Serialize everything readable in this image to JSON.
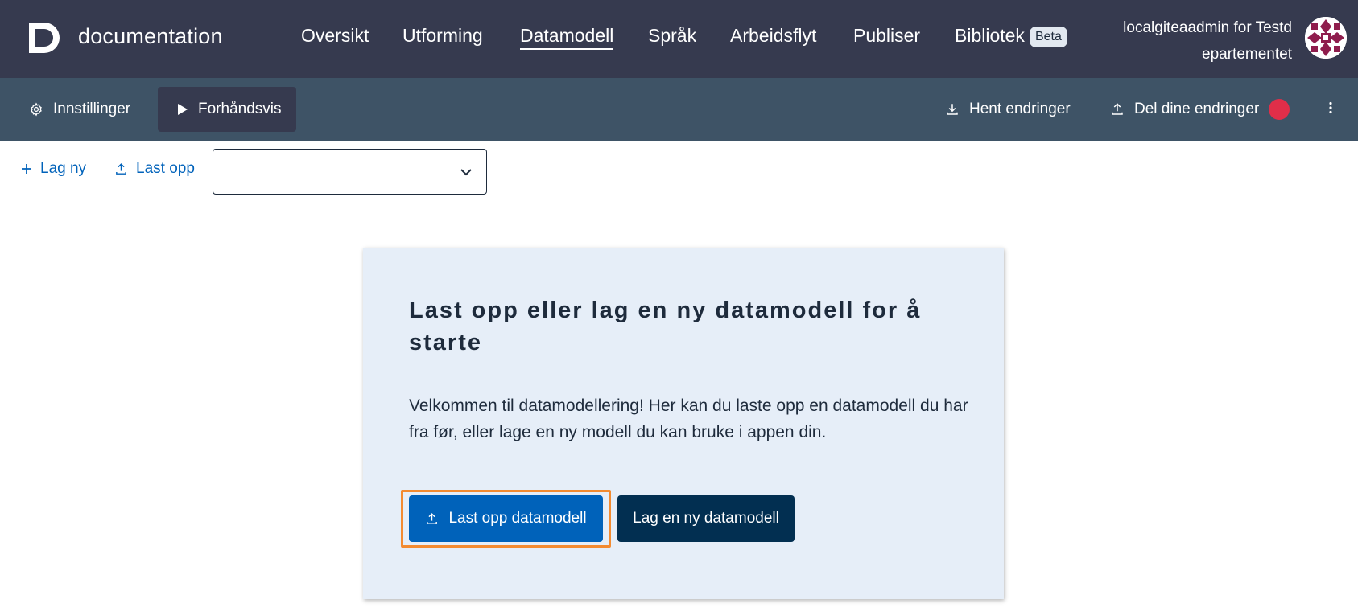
{
  "header": {
    "app_title": "documentation",
    "nav": [
      "Oversikt",
      "Utforming",
      "Datamodell",
      "Språk",
      "Arbeidsflyt",
      "Publiser",
      "Bibliotek"
    ],
    "active_nav": "Datamodell",
    "beta_badge": "Beta",
    "user_line1": "localgiteaadmin for Testd",
    "user_line2": "epartementet",
    "logo_icon": "altinn-studio-logo-icon",
    "avatar_icon": "org-avatar-icon"
  },
  "subbar": {
    "settings_label": "Innstillinger",
    "preview_label": "Forhåndsvis",
    "fetch_label": "Hent endringer",
    "share_label": "Del dine endringer",
    "more_icon": "kebab-menu-icon",
    "notify_color": "#e02e49"
  },
  "toolbar": {
    "create_label": "Lag ny",
    "upload_label": "Last opp",
    "select_value": ""
  },
  "card": {
    "heading": "Last opp eller lag en ny datamodell for å starte",
    "text": "Velkommen til datamodellering! Her kan du laste opp en datamodell du har fra før, eller lage en ny modell du kan bruke i appen din.",
    "upload_button": "Last opp datamodell",
    "create_button": "Lag en ny datamodell"
  },
  "colors": {
    "header_bg": "#363a4f",
    "subbar_bg": "#3e5366",
    "primary": "#0062ba",
    "dark_button": "#022f51",
    "card_bg": "#e6eef8",
    "focus": "#f38b31"
  }
}
